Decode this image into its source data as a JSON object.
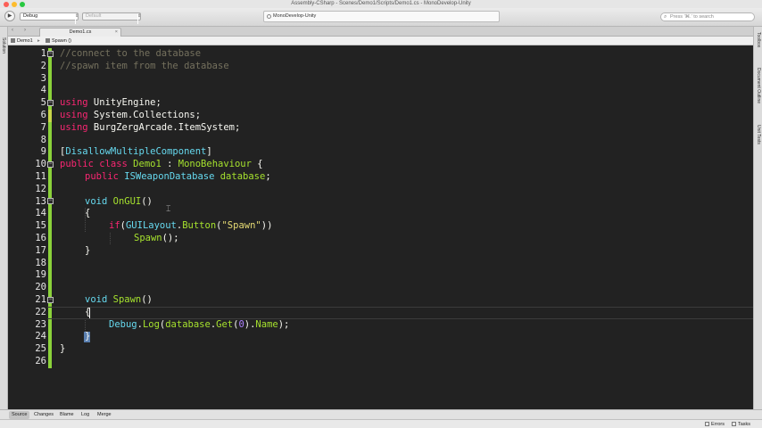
{
  "window": {
    "title": "Assembly-CSharp - Scenes/Demo1/Scripts/Demo1.cs - MonoDevelop-Unity",
    "traffic_colors": [
      "#fc5f57",
      "#fdbc2e",
      "#28c840"
    ]
  },
  "toolbar": {
    "run_icon": "play-icon",
    "config_value": "Debug",
    "platform_value": "Default",
    "status_text": "MonoDevelop-Unity",
    "search_placeholder": "Press '⌘.' to search"
  },
  "left_pad": {
    "solution_label": "Solution"
  },
  "right_pad": {
    "toolbox_label": "Toolbox",
    "outline_label": "Document Outline",
    "unit_tests_label": "Unit Tests"
  },
  "tabs": {
    "doc_tab_label": "Demo1.cs",
    "close_glyph": "×"
  },
  "breadcrumb": {
    "file": "Demo1",
    "member": "Spawn ()"
  },
  "editor": {
    "line_numbers": [
      "1",
      "2",
      "3",
      "4",
      "5",
      "6",
      "7",
      "8",
      "9",
      "10",
      "11",
      "12",
      "13",
      "14",
      "15",
      "16",
      "17",
      "18",
      "19",
      "20",
      "21",
      "22",
      "23",
      "24",
      "25",
      "26"
    ],
    "colors": {
      "comment": "#75715e",
      "keyword": "#f92672",
      "type": "#66d9ef",
      "call": "#a6e22e",
      "string": "#e6db74",
      "number": "#ae81ff",
      "change_bar": "#8bd23a"
    },
    "lines": {
      "l1": "//connect to the database",
      "l2": "//spawn item from the database",
      "l5_kw": "using",
      "l5_rest": " UnityEngine;",
      "l6_kw": "using",
      "l6_rest": " System.Collections;",
      "l7_kw": "using",
      "l7_rest": " BurgZergArcade.ItemSystem;",
      "l9_open": "[",
      "l9_attr": "DisallowMultipleComponent",
      "l9_close": "]",
      "l10_kw": "public class",
      "l10_name": " Demo1",
      "l10_colon": " : ",
      "l10_base": "MonoBehaviour",
      "l10_brace": " {",
      "l11_kw": "public",
      "l11_type": " ISWeaponDatabase",
      "l11_name": " database",
      "l11_semi": ";",
      "l13_kw": "void",
      "l13_name": " OnGUI",
      "l13_parens": "()",
      "l14": "{",
      "l15_kw": "if",
      "l15_p1": "(",
      "l15_cls": "GUILayout",
      "l15_dot": ".",
      "l15_fn": "Button",
      "l15_p2": "(",
      "l15_str": "\"Spawn\"",
      "l15_p3": "))",
      "l16_fn": "Spawn",
      "l16_rest": "();",
      "l17": "}",
      "l21_kw": "void",
      "l21_name": " Spawn",
      "l21_parens": "()",
      "l22": "{",
      "l23_cls": "Debug",
      "l23_dot1": ".",
      "l23_fn": "Log",
      "l23_p1": "(",
      "l23_obj": "database",
      "l23_dot2": ".",
      "l23_get": "Get",
      "l23_p2": "(",
      "l23_num": "0",
      "l23_p3": ")",
      "l23_dot3": ".",
      "l23_prop": "Name",
      "l23_end": ");",
      "l24": "}",
      "l25": "}"
    }
  },
  "bottom_tabs": [
    "Source",
    "Changes",
    "Blame",
    "Log",
    "Merge"
  ],
  "status_items": {
    "errors": "Errors",
    "tasks": "Tasks"
  }
}
